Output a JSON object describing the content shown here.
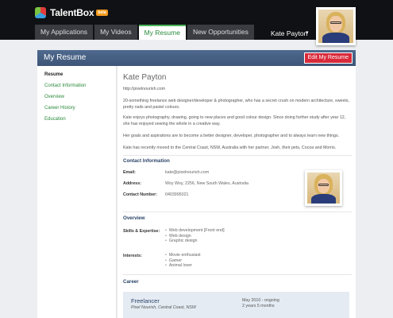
{
  "app": {
    "logo_text": "TalentBox",
    "logo_badge": "beta"
  },
  "tabs": [
    {
      "label": "My Applications"
    },
    {
      "label": "My Videos"
    },
    {
      "label": "My Resume",
      "active": true
    },
    {
      "label": "New Opportunities"
    }
  ],
  "user": {
    "name": "Kate Payton",
    "caret": "▾"
  },
  "banner": {
    "title": "My Resume",
    "edit_label": "Edit My Resume"
  },
  "sidebar": {
    "items": [
      {
        "label": "Resume",
        "active": true
      },
      {
        "label": "Contact Information"
      },
      {
        "label": "Overview"
      },
      {
        "label": "Career History"
      },
      {
        "label": "Education"
      }
    ]
  },
  "profile": {
    "name": "Kate Payton",
    "url": "http://pixelnourish.com",
    "bio": [
      "20-something freelance web designer/developer & photographer, who has a secret crush on modern architecture, sweets, pretty nails and pastel colours.",
      "Kate enjoys photography, drawing, going to new places and good colour design. Since doing further study after year 12, she has enjoyed sewing the whole in a creative way.",
      "Her goals and aspirations are to become a better designer, developer, photographer and to always learn new things.",
      "Kate has recently moved to the Central Coast, NSW, Australia with her partner, Josh, their pets, Cocoa and Morris."
    ]
  },
  "contact": {
    "heading": "Contact Information",
    "email_label": "Email:",
    "email": "kate@pixelnourish.com",
    "address_label": "Address:",
    "address": "Woy Woy, 2256, New South Wales, Australia",
    "phone_label": "Contact Number:",
    "phone": "0403995021"
  },
  "overview": {
    "heading": "Overview",
    "skills_label": "Skills & Expertise:",
    "skills": [
      "Web development [Front end]",
      "Web design",
      "Graphic design"
    ],
    "interests_label": "Interests:",
    "interests": [
      "Movie enthusiast",
      "Gamer",
      "Animal lover"
    ]
  },
  "career": {
    "heading": "Career",
    "jobs": [
      {
        "title": "Freelancer",
        "company": "Pixel Nourish, Central Coast, NSW",
        "dates": "May 2010 - ongoing",
        "duration": "2 years 5 months"
      }
    ]
  }
}
